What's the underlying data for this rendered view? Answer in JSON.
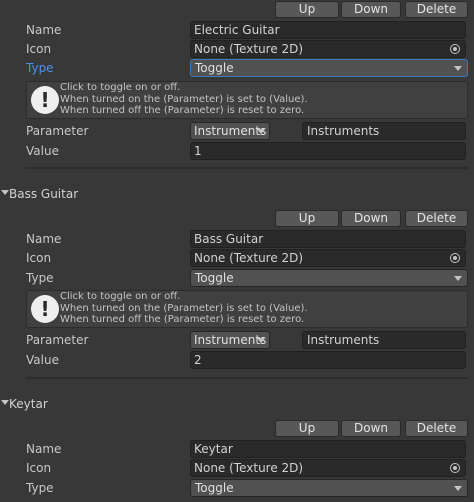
{
  "buttons": {
    "up": "Up",
    "down": "Down",
    "delete": "Delete"
  },
  "labels": {
    "name": "Name",
    "icon": "Icon",
    "type": "Type",
    "parameter": "Parameter",
    "value": "Value"
  },
  "help": {
    "line1": "Click to toggle on or off.",
    "line2": "When turned on the (Parameter) is set to (Value).",
    "line3": "When turned off the (Parameter) is reset to zero."
  },
  "controls": [
    {
      "name": "Electric Guitar",
      "icon": "None (Texture 2D)",
      "type": "Toggle",
      "parameter_menu": "Instruments",
      "parameter": "Instruments",
      "value": "1"
    },
    {
      "header": "Bass Guitar",
      "name": "Bass Guitar",
      "icon": "None (Texture 2D)",
      "type": "Toggle",
      "parameter_menu": "Instruments",
      "parameter": "Instruments",
      "value": "2"
    },
    {
      "header": "Keytar",
      "name": "Keytar",
      "icon": "None (Texture 2D)",
      "type": "Toggle"
    }
  ],
  "icons": {
    "object_picker": "object-picker-icon",
    "dropdown": "dropdown-caret-icon",
    "foldout": "foldout-arrow-icon",
    "warning": "exclamation-icon"
  }
}
